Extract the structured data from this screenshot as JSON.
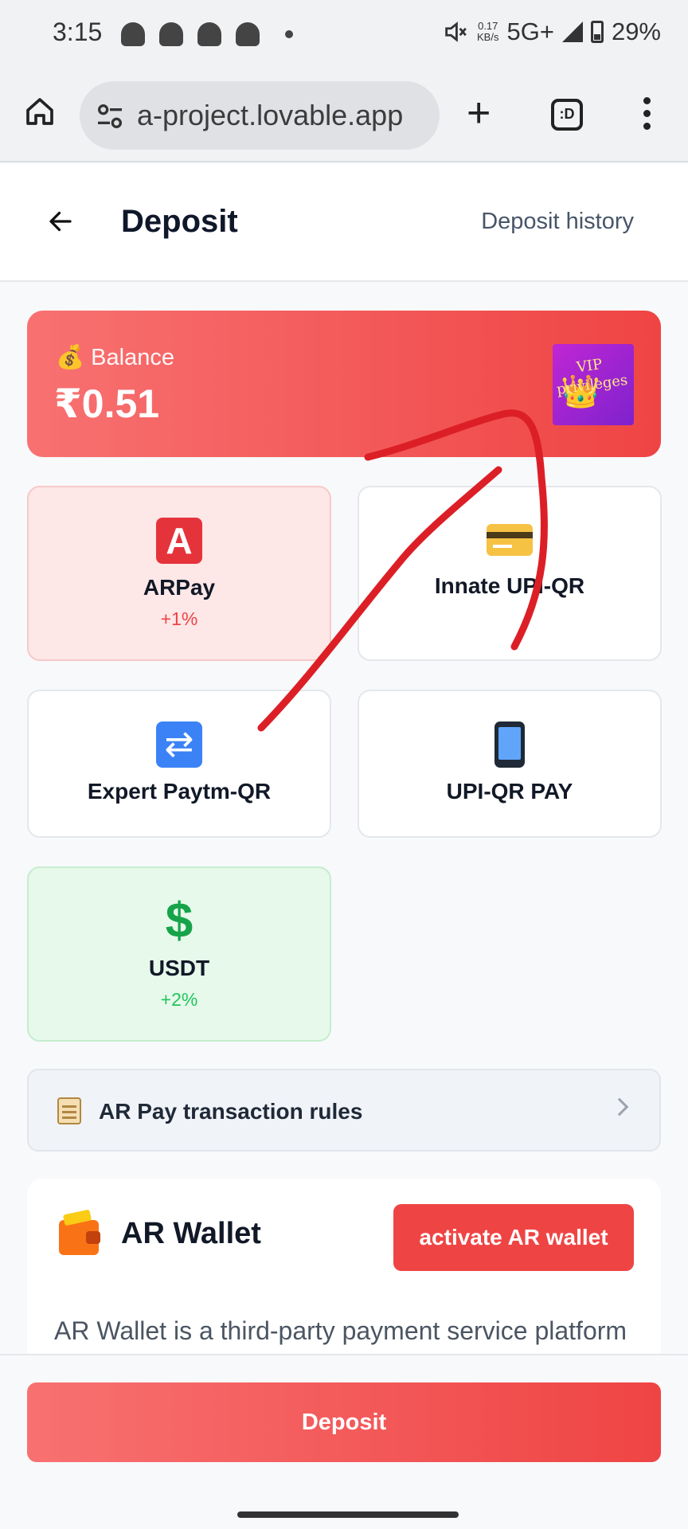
{
  "status_bar": {
    "time": "3:15",
    "net_speed": "0.17",
    "net_unit": "KB/s",
    "network": "5G+",
    "battery": "29%"
  },
  "browser": {
    "url": "a-project.lovable.app",
    "tabs_label": ":D"
  },
  "header": {
    "title": "Deposit",
    "history_link": "Deposit history"
  },
  "balance": {
    "label": "💰 Balance",
    "amount": "₹0.51",
    "vip_label": "VIP privileges"
  },
  "methods": [
    {
      "name": "ARPay",
      "bonus": "+1%",
      "icon": "letter-a-icon"
    },
    {
      "name": "Innate UPI-QR",
      "bonus": "",
      "icon": "credit-card-icon"
    },
    {
      "name": "Expert Paytm-QR",
      "bonus": "",
      "icon": "sync-arrows-icon"
    },
    {
      "name": "UPI-QR PAY",
      "bonus": "",
      "icon": "mobile-phone-icon"
    },
    {
      "name": "USDT",
      "bonus": "+2%",
      "icon": "dollar-icon"
    }
  ],
  "rules": {
    "label": "AR Pay transaction rules"
  },
  "wallet": {
    "title": "AR Wallet",
    "activate_button": "activate AR wallet",
    "description": "AR Wallet is a third-party payment service platform that facilitates fast payments on the"
  },
  "footer": {
    "deposit_button": "Deposit"
  },
  "colors": {
    "accent": "#ef4444",
    "accent_light": "#f87171",
    "annotation": "#dc1f26"
  }
}
